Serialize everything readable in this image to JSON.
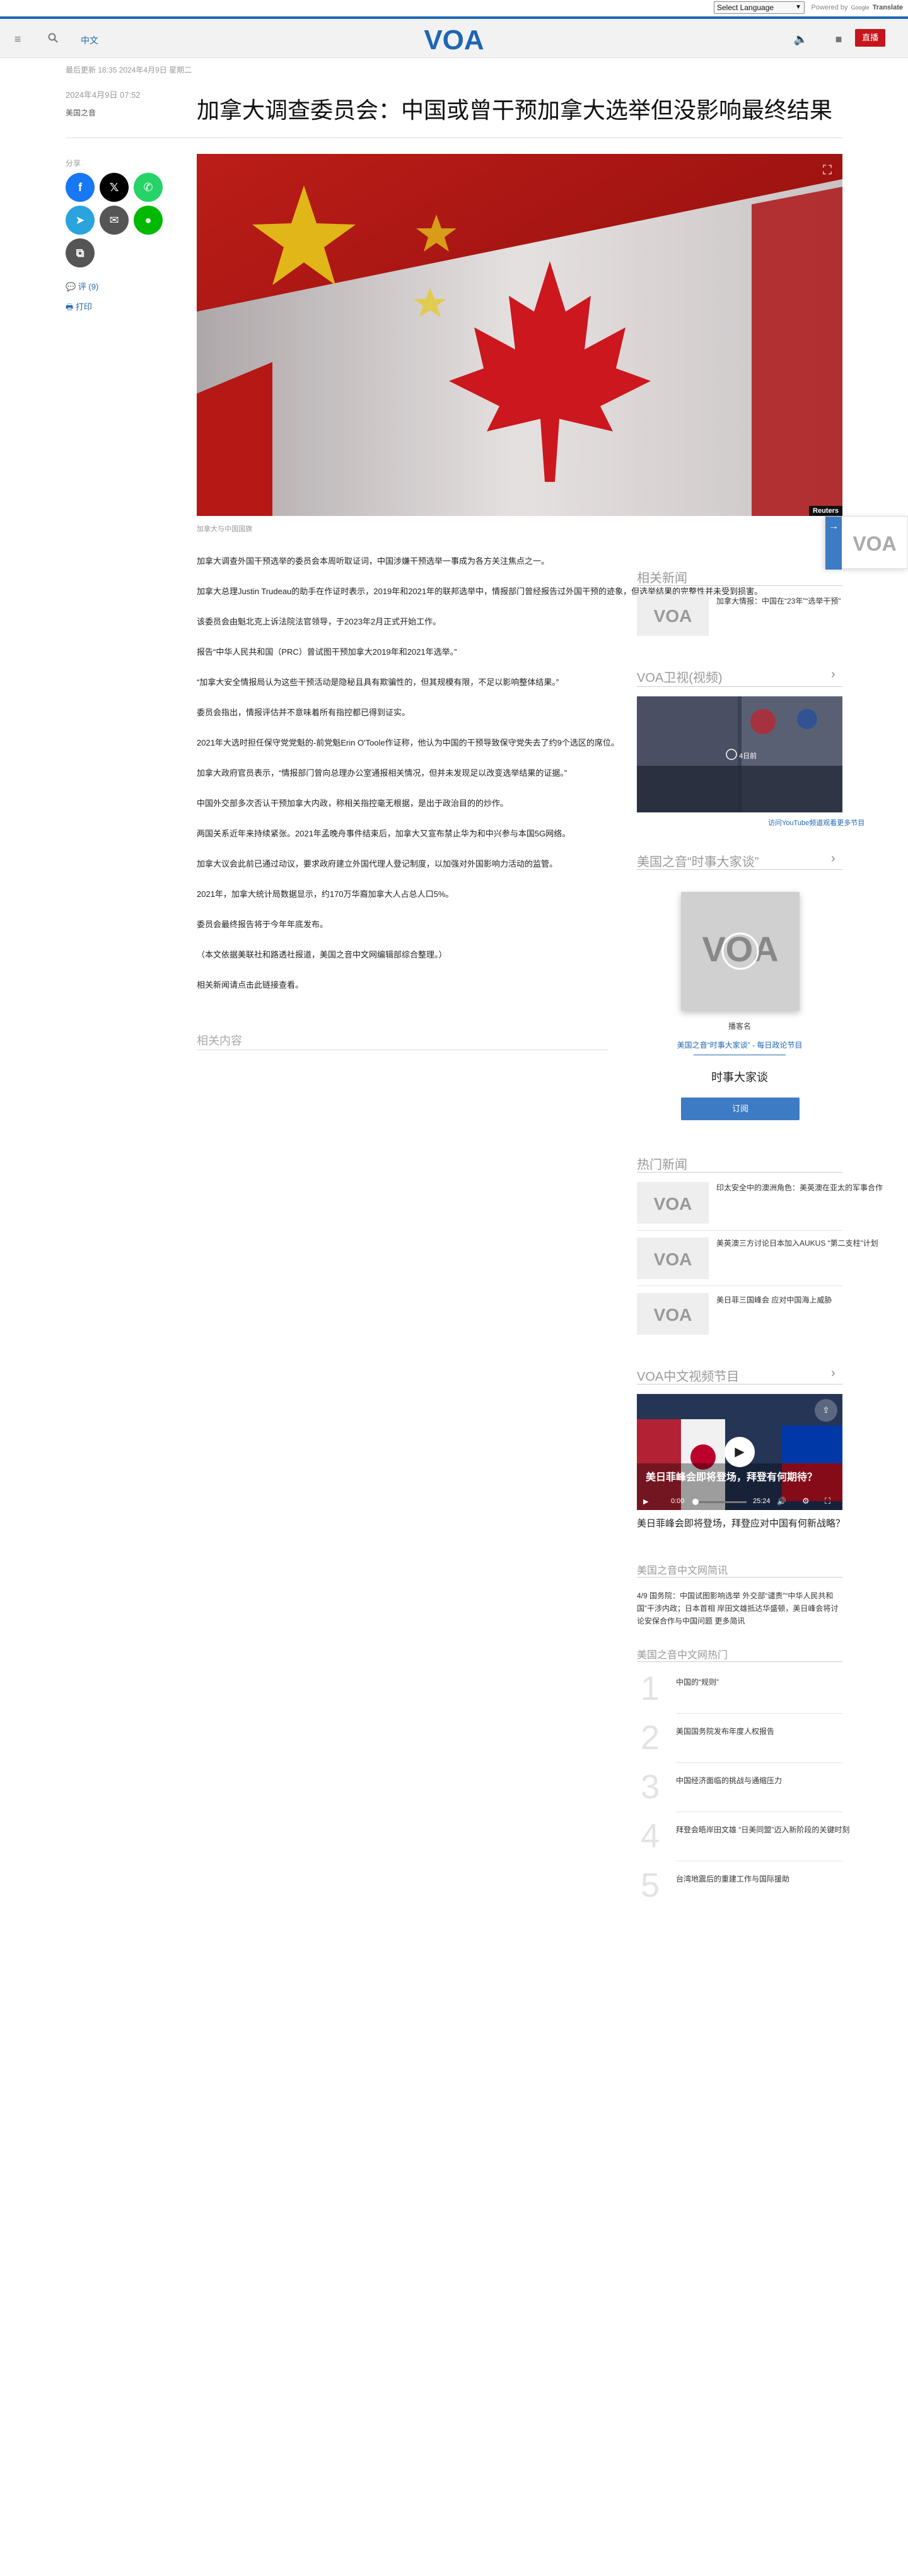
{
  "translate": {
    "select_label": "Select Language",
    "powered_by": "Powered by",
    "google": "Google",
    "translate": "Translate"
  },
  "header": {
    "menu_icon": "hamburger-icon",
    "search_icon": "search-icon",
    "link_label": "中文",
    "audio_icon": "speaker-icon",
    "video_icon": "video-camera-icon",
    "live_label": "直播",
    "brand_color": "#1f66b3",
    "live_color": "#c4161c"
  },
  "article": {
    "updated": "最后更新 18:35 2024年4月9日 星期二",
    "date": "2024年4月9日 07:52",
    "author": "美国之音",
    "title": "加拿大调查委员会：中国或曾干预加拿大选举但没影响最终结果",
    "photo_credit": "Reuters",
    "caption": "加拿大与中国国旗",
    "paragraphs": [
      "加拿大调查外国干预选举的委员会本周听取证词，中国涉嫌干预选举一事成为各方关注焦点之一。",
      "加拿大总理Justin Trudeau的助手在作证时表示，2019年和2021年的联邦选举中，情报部门曾经报告过外国干预的迹象，但选举结果的完整性并未受到损害。",
      "该委员会由魁北克上诉法院法官领导，于2023年2月正式开始工作。",
      "报告“中华人民共和国（PRC）曾试图干预加拿大2019年和2021年选举。”",
      "“加拿大安全情报局认为这些干预活动是隐秘且具有欺骗性的，但其规模有限，不足以影响整体结果。”",
      "委员会指出，情报评估并不意味着所有指控都已得到证实。",
      "2021年大选时担任保守党党魁的-前党魁Erin O'Toole作证称，他认为中国的干预导致保守党失去了约9个选区的席位。",
      "加拿大政府官员表示，“情报部门曾向总理办公室通报相关情况，但并未发现足以改变选举结果的证据。”",
      "中国外交部多次否认干预加拿大内政，称相关指控毫无根据，是出于政治目的的炒作。",
      "两国关系近年来持续紧张。2021年孟晚舟事件结束后，加拿大又宣布禁止华为和中兴参与本国5G网络。",
      "加拿大议会此前已通过动议，要求政府建立外国代理人登记制度，以加强对外国影响力活动的监管。",
      "2021年，加拿大统计局数据显示，约170万华裔加拿大人占总人口5%。",
      "委员会最终报告将于今年年底发布。",
      "（本文依据美联社和路透社报道，美国之音中文网编辑部综合整理。）",
      "相关新闻请点击此链接查看。"
    ],
    "related_title": "相关内容"
  },
  "share": {
    "label": "分享",
    "facebook_color": "#1877f2",
    "x_color": "#000000",
    "whatsapp_color": "#25d366",
    "telegram_color": "#2aa3df",
    "email_color": "#555555",
    "line_color": "#00b900",
    "copy_color": "#555555",
    "comments": "评 (9)",
    "print": "打印"
  },
  "sidebar": {
    "news_title": "相关新闻",
    "news_item": "加拿大情报：中国在“23年”“选举干预”",
    "voa_section_title": "VOA卫视(视频)",
    "yt_timestamp": "4日前",
    "yt_link": "访问YouTube频道观看更多节目",
    "podcast_title": "美国之音“时事大家谈”",
    "podcast_name": "播客名",
    "podcast_sub": "美国之音“时事大家谈” - 每日政论节目",
    "podcast_headline": "时事大家谈",
    "podcast_btn": "订阅",
    "hot_title": "热门新闻",
    "hot_items": [
      "印太安全中的澳洲角色：美英澳在亚太的军事合作",
      "美英澳三方讨论日本加入AUKUS “第二支柱”计划",
      "美日菲三国峰会 应对中国海上威胁"
    ],
    "video_section_title": "VOA中文视频节目",
    "video_overlay": "美日菲峰会即将登场，拜登有何期待？",
    "video_time_current": "0:00",
    "video_time_total": "25:24",
    "video_caption": "美日菲峰会即将登场，拜登应对中国有何新战略？",
    "briefs_title": "美国之音中文网简讯",
    "briefs_text": "4/9 国务院：中国试图影响选举 外交部“谴责”“中华人民共和国”干涉内政；日本首相 岸田文雄抵达华盛顿，美日峰会将讨论安保合作与中国问题 更多简讯",
    "popular_title": "美国之音中文网热门",
    "popular_items": [
      "中国的“规则”",
      "美国国务院发布年度人权报告",
      "中国经济面临的挑战与通缩压力",
      "拜登会晤岸田文雄 “日美同盟”迈入新阶段的关键时刻",
      "台湾地震后的重建工作与国际援助"
    ]
  }
}
